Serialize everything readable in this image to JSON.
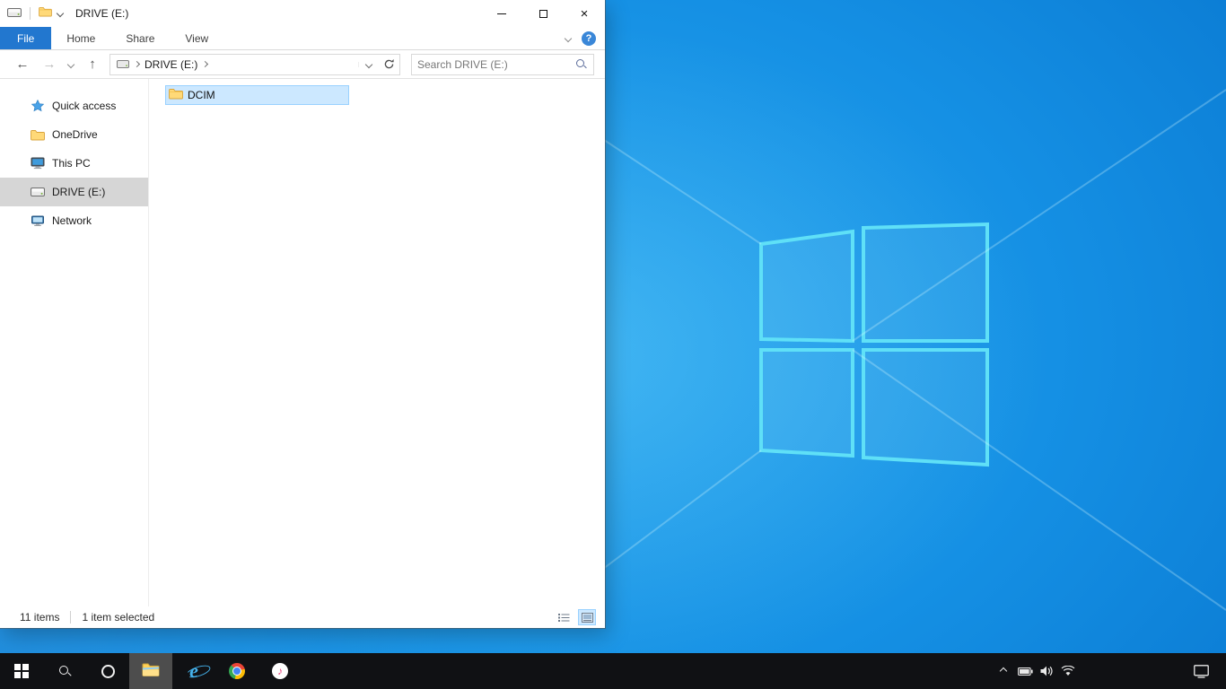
{
  "colors": {
    "accent_blue": "#2277cf",
    "selection_bg": "#cce8ff",
    "selection_border": "#99d1ff",
    "wallpaper_blue": "#0a7ad2",
    "logo_cyan": "#5fe0f7",
    "taskbar_bg": "#101114"
  },
  "titlebar": {
    "title": "DRIVE (E:)"
  },
  "ribbon": {
    "tabs": [
      {
        "label": "File"
      },
      {
        "label": "Home"
      },
      {
        "label": "Share"
      },
      {
        "label": "View"
      }
    ],
    "help_label": "?"
  },
  "navbar": {
    "back_glyph": "←",
    "forward_glyph": "→",
    "up_glyph": "↑",
    "breadcrumb_drive": "DRIVE (E:)",
    "search_placeholder": "Search DRIVE (E:)"
  },
  "sidebar": {
    "items": [
      {
        "label": "Quick access",
        "icon": "star-icon",
        "selected": false
      },
      {
        "label": "OneDrive",
        "icon": "folder-icon",
        "selected": false
      },
      {
        "label": "This PC",
        "icon": "computer-icon",
        "selected": false
      },
      {
        "label": "DRIVE (E:)",
        "icon": "drive-icon",
        "selected": true
      },
      {
        "label": "Network",
        "icon": "network-icon",
        "selected": false
      }
    ]
  },
  "content": {
    "files": [
      {
        "label": "DCIM",
        "icon": "folder-icon",
        "selected": true
      }
    ]
  },
  "statusbar": {
    "items_count": "11 items",
    "selection": "1 item selected"
  },
  "taskbar": {
    "buttons": [
      {
        "name": "start",
        "icon": "windows-logo-icon",
        "active": false
      },
      {
        "name": "search",
        "icon": "search-icon",
        "active": false
      },
      {
        "name": "cortana",
        "icon": "cortana-icon",
        "active": false
      },
      {
        "name": "file-explorer",
        "icon": "file-explorer-icon",
        "active": true
      },
      {
        "name": "internet-explorer",
        "icon": "ie-icon",
        "active": false,
        "glyph": "e"
      },
      {
        "name": "chrome",
        "icon": "chrome-icon",
        "active": false
      },
      {
        "name": "itunes",
        "icon": "itunes-icon",
        "active": false,
        "glyph": "♪"
      }
    ],
    "tray_icons": [
      "chevron-up-icon",
      "battery-icon",
      "volume-icon",
      "wifi-icon"
    ],
    "action_center_icon": "action-center-icon"
  }
}
